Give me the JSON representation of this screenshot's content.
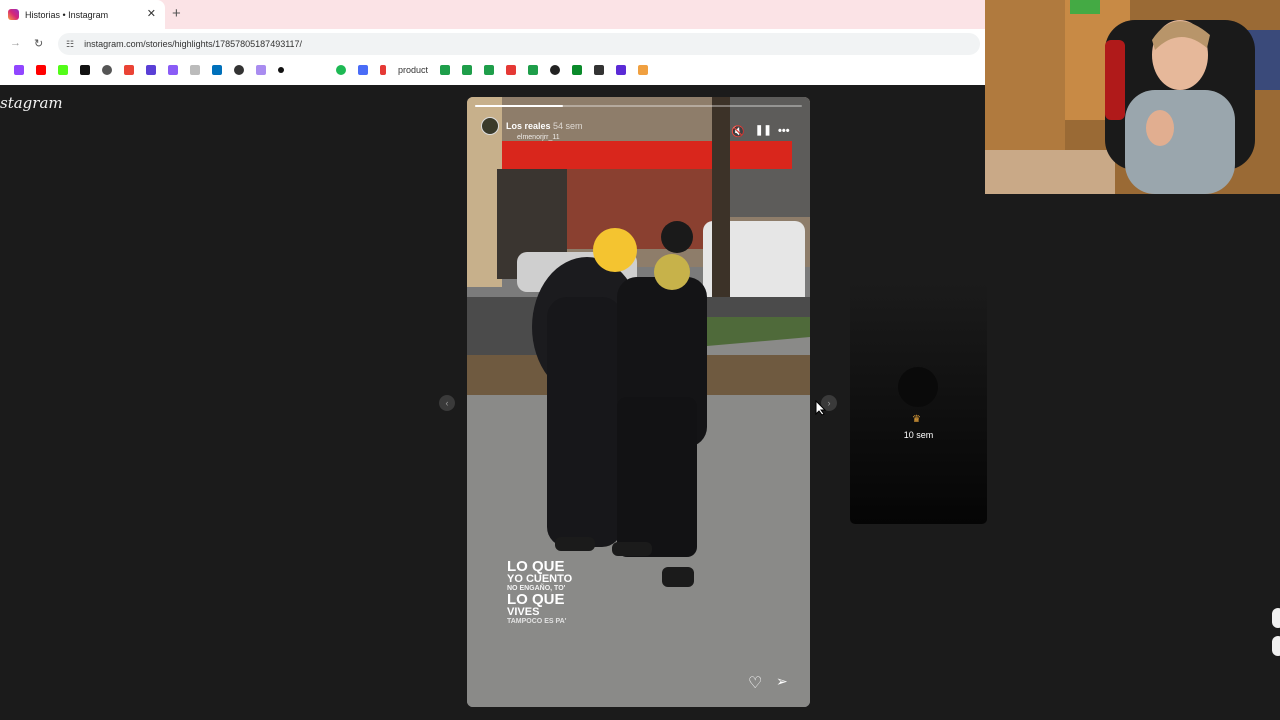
{
  "browser": {
    "tab_title": "Historias • Instagram",
    "tab_close": "✕",
    "new_tab": "+",
    "url": "instagram.com/stories/highlights/17857805187493117/",
    "bookmark_label": "product",
    "accent_tab_strip": "#fbe3e6"
  },
  "page": {
    "logo_text": "stagram"
  },
  "story": {
    "username": "Los reales",
    "time_ago": "54 sem",
    "music_label": "elmenorjrr_11",
    "progress": 0.27,
    "overlay_text": {
      "line1": "LO QUE",
      "line2": "YO CUENTO",
      "line3": "NO ENGAÑO, TO'",
      "line4": "LO QUE",
      "line5": "VIVES",
      "line6": "TAMPOCO ES PA'"
    }
  },
  "next_story": {
    "time_ago": "10 sem"
  },
  "icons": {
    "mute": "speaker-muted-icon",
    "pause": "pause-icon",
    "more": "more-options-icon",
    "heart": "heart-icon",
    "send": "send-icon"
  }
}
